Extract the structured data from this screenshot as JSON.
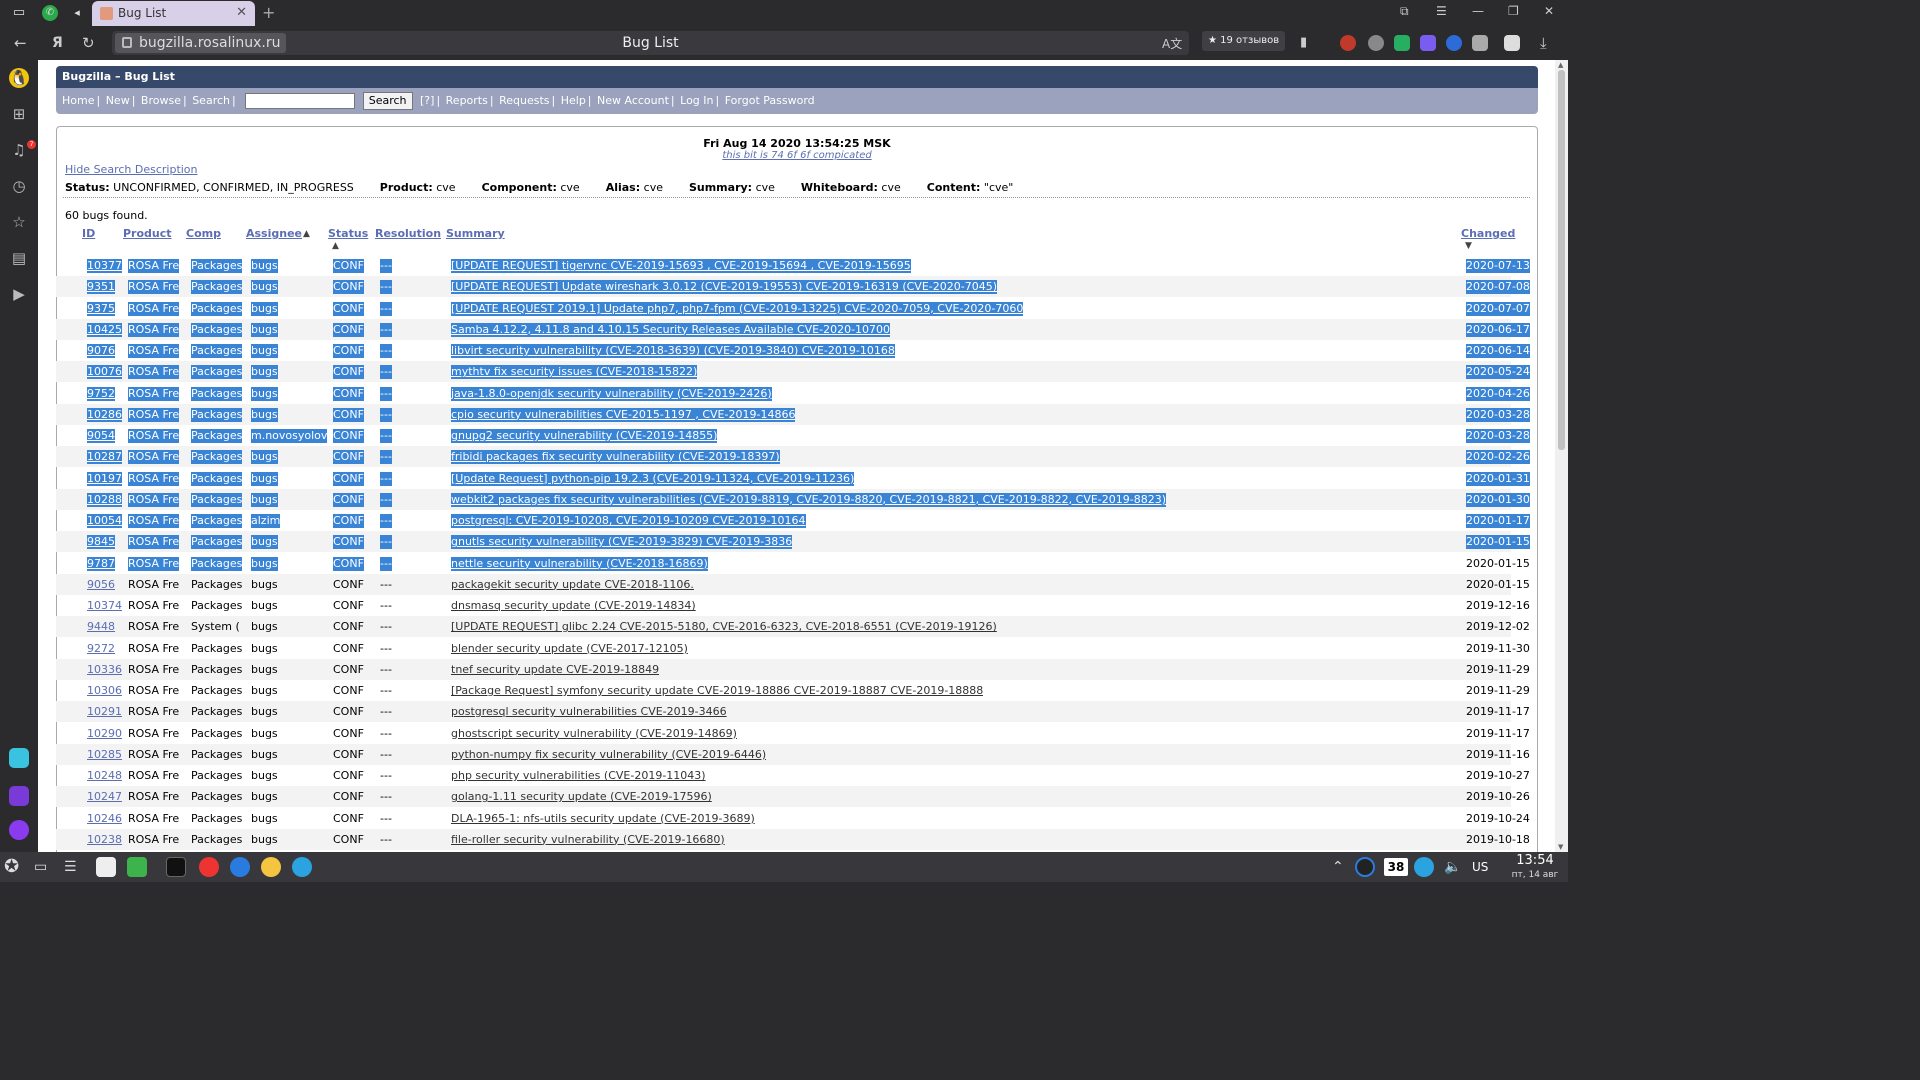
{
  "browser": {
    "tab_title": "Bug List",
    "url_host": "bugzilla.rosalinux.ru",
    "page_title": "Bug List",
    "reviews_label": "19 отзывов",
    "sidebar_notification_count": "7"
  },
  "bugzilla": {
    "header_title": "Bugzilla – Bug List",
    "nav_links": [
      "Home",
      "New",
      "Browse",
      "Search"
    ],
    "search_button": "Search",
    "help_link": "[?]",
    "nav_links_right": [
      "Reports",
      "Requests",
      "Help",
      "New Account",
      "Log In",
      "Forgot Password"
    ],
    "date_line": "Fri Aug 14 2020 13:54:25 MSK",
    "sub_line": "this bit is 74 6f 6f compicated",
    "hide_search_description": "Hide Search Description",
    "criteria": [
      {
        "label": "Status:",
        "value": "UNCONFIRMED, CONFIRMED, IN_PROGRESS"
      },
      {
        "label": "Product:",
        "value": "cve"
      },
      {
        "label": "Component:",
        "value": "cve"
      },
      {
        "label": "Alias:",
        "value": "cve"
      },
      {
        "label": "Summary:",
        "value": "cve"
      },
      {
        "label": "Whiteboard:",
        "value": "cve"
      },
      {
        "label": "Content:",
        "value": "\"cve\""
      }
    ],
    "bugs_found": "60 bugs found.",
    "columns": {
      "id": "ID",
      "product": "Product",
      "comp": "Comp",
      "assignee": "Assignee",
      "status": "Status",
      "resolution": "Resolution",
      "summary": "Summary",
      "changed": "Changed"
    },
    "rows": [
      {
        "id": "10377",
        "product": "ROSA Fre",
        "comp": "Packages",
        "assignee": "bugs",
        "status": "CONF",
        "resolution": "---",
        "summary": "[UPDATE REQUEST] tigervnc CVE-2019-15693 , CVE-2019-15694 , CVE-2019-15695",
        "changed": "2020-07-13",
        "selected": true
      },
      {
        "id": "9351",
        "product": "ROSA Fre",
        "comp": "Packages",
        "assignee": "bugs",
        "status": "CONF",
        "resolution": "---",
        "summary": "[UPDATE REQUEST] Update wireshark 3.0.12 (CVE-2019-19553) CVE-2019-16319 (CVE-2020-7045)",
        "changed": "2020-07-08",
        "selected": true
      },
      {
        "id": "9375",
        "product": "ROSA Fre",
        "comp": "Packages",
        "assignee": "bugs",
        "status": "CONF",
        "resolution": "---",
        "summary": "[UPDATE REQUEST 2019.1] Update php7, php7-fpm (CVE-2019-13225) CVE-2020-7059, CVE-2020-7060",
        "changed": "2020-07-07",
        "selected": true
      },
      {
        "id": "10425",
        "product": "ROSA Fre",
        "comp": "Packages",
        "assignee": "bugs",
        "status": "CONF",
        "resolution": "---",
        "summary": "Samba 4.12.2, 4.11.8 and 4.10.15 Security Releases Available CVE-2020-10700",
        "changed": "2020-06-17",
        "selected": true
      },
      {
        "id": "9076",
        "product": "ROSA Fre",
        "comp": "Packages",
        "assignee": "bugs",
        "status": "CONF",
        "resolution": "---",
        "summary": "libvirt security vulnerability (CVE-2018-3639) (CVE-2019-3840) CVE-2019-10168",
        "changed": "2020-06-14",
        "selected": true
      },
      {
        "id": "10076",
        "product": "ROSA Fre",
        "comp": "Packages",
        "assignee": "bugs",
        "status": "CONF",
        "resolution": "---",
        "summary": "mythtv fix security issues (CVE-2018-15822)",
        "changed": "2020-05-24",
        "selected": true
      },
      {
        "id": "9752",
        "product": "ROSA Fre",
        "comp": "Packages",
        "assignee": "bugs",
        "status": "CONF",
        "resolution": "---",
        "summary": "java-1.8.0-openjdk security vulnerability (CVE-2019-2426)",
        "changed": "2020-04-26",
        "selected": true
      },
      {
        "id": "10286",
        "product": "ROSA Fre",
        "comp": "Packages",
        "assignee": "bugs",
        "status": "CONF",
        "resolution": "---",
        "summary": "cpio security vulnerabilities CVE-2015-1197 , CVE-2019-14866",
        "changed": "2020-03-28",
        "selected": true
      },
      {
        "id": "9054",
        "product": "ROSA Fre",
        "comp": "Packages",
        "assignee": "m.novosyolov",
        "status": "CONF",
        "resolution": "---",
        "summary": "gnupg2 security vulnerability (CVE-2019-14855)",
        "changed": "2020-03-28",
        "selected": true
      },
      {
        "id": "10287",
        "product": "ROSA Fre",
        "comp": "Packages",
        "assignee": "bugs",
        "status": "CONF",
        "resolution": "---",
        "summary": "fribidi packages fix security vulnerability (CVE-2019-18397)",
        "changed": "2020-02-26",
        "selected": true
      },
      {
        "id": "10197",
        "product": "ROSA Fre",
        "comp": "Packages",
        "assignee": "bugs",
        "status": "CONF",
        "resolution": "---",
        "summary": "[Update Request] python-pip 19.2.3 (CVE-2019-11324, CVE-2019-11236)",
        "changed": "2020-01-31",
        "selected": true
      },
      {
        "id": "10288",
        "product": "ROSA Fre",
        "comp": "Packages",
        "assignee": "bugs",
        "status": "CONF",
        "resolution": "---",
        "summary": "webkit2 packages fix security vulnerabilities (CVE-2019-8819, CVE-2019-8820, CVE-2019-8821, CVE-2019-8822, CVE-2019-8823)",
        "changed": "2020-01-30",
        "selected": true
      },
      {
        "id": "10054",
        "product": "ROSA Fre",
        "comp": "Packages",
        "assignee": "alzim",
        "status": "CONF",
        "resolution": "---",
        "summary": "postgresql: CVE-2019-10208, CVE-2019-10209 CVE-2019-10164",
        "changed": "2020-01-17",
        "selected": true
      },
      {
        "id": "9845",
        "product": "ROSA Fre",
        "comp": "Packages",
        "assignee": "bugs",
        "status": "CONF",
        "resolution": "---",
        "summary": "gnutls security vulnerability (CVE-2019-3829) CVE-2019-3836",
        "changed": "2020-01-15",
        "selected": true
      },
      {
        "id": "9787",
        "product": "ROSA Fre",
        "comp": "Packages",
        "assignee": "bugs",
        "status": "CONF",
        "resolution": "---",
        "summary": "nettle security vulnerability (CVE-2018-16869)",
        "changed": "2020-01-15",
        "selected": true,
        "changed_plain": true
      },
      {
        "id": "9056",
        "product": "ROSA Fre",
        "comp": "Packages",
        "assignee": "bugs",
        "status": "CONF",
        "resolution": "---",
        "summary": "packagekit security update CVE-2018-1106.",
        "changed": "2020-01-15",
        "selected": false
      },
      {
        "id": "10374",
        "product": "ROSA Fre",
        "comp": "Packages",
        "assignee": "bugs",
        "status": "CONF",
        "resolution": "---",
        "summary": "dnsmasq security update (CVE-2019-14834)",
        "changed": "2019-12-16",
        "selected": false
      },
      {
        "id": "9448",
        "product": "ROSA Fre",
        "comp": "System (",
        "assignee": "bugs",
        "status": "CONF",
        "resolution": "---",
        "summary": "[UPDATE REQUEST] glibc 2.24 CVE-2015-5180, CVE-2016-6323, CVE-2018-6551 (CVE-2019-19126)",
        "changed": "2019-12-02",
        "selected": false
      },
      {
        "id": "9272",
        "product": "ROSA Fre",
        "comp": "Packages",
        "assignee": "bugs",
        "status": "CONF",
        "resolution": "---",
        "summary": "blender security update (CVE-2017-12105)",
        "changed": "2019-11-30",
        "selected": false
      },
      {
        "id": "10336",
        "product": "ROSA Fre",
        "comp": "Packages",
        "assignee": "bugs",
        "status": "CONF",
        "resolution": "---",
        "summary": "tnef security update CVE-2019-18849",
        "changed": "2019-11-29",
        "selected": false
      },
      {
        "id": "10306",
        "product": "ROSA Fre",
        "comp": "Packages",
        "assignee": "bugs",
        "status": "CONF",
        "resolution": "---",
        "summary": "[Package Request] symfony security update CVE-2019-18886 CVE-2019-18887 CVE-2019-18888",
        "changed": "2019-11-29",
        "selected": false
      },
      {
        "id": "10291",
        "product": "ROSA Fre",
        "comp": "Packages",
        "assignee": "bugs",
        "status": "CONF",
        "resolution": "---",
        "summary": "postgresql security vulnerabilities CVE-2019-3466",
        "changed": "2019-11-17",
        "selected": false
      },
      {
        "id": "10290",
        "product": "ROSA Fre",
        "comp": "Packages",
        "assignee": "bugs",
        "status": "CONF",
        "resolution": "---",
        "summary": "ghostscript security vulnerability (CVE-2019-14869)",
        "changed": "2019-11-17",
        "selected": false
      },
      {
        "id": "10285",
        "product": "ROSA Fre",
        "comp": "Packages",
        "assignee": "bugs",
        "status": "CONF",
        "resolution": "---",
        "summary": "python-numpy fix security vulnerability (CVE-2019-6446)",
        "changed": "2019-11-16",
        "selected": false
      },
      {
        "id": "10248",
        "product": "ROSA Fre",
        "comp": "Packages",
        "assignee": "bugs",
        "status": "CONF",
        "resolution": "---",
        "summary": "php security vulnerabilities (CVE-2019-11043)",
        "changed": "2019-10-27",
        "selected": false
      },
      {
        "id": "10247",
        "product": "ROSA Fre",
        "comp": "Packages",
        "assignee": "bugs",
        "status": "CONF",
        "resolution": "---",
        "summary": "golang-1.11 security update (CVE-2019-17596)",
        "changed": "2019-10-26",
        "selected": false
      },
      {
        "id": "10246",
        "product": "ROSA Fre",
        "comp": "Packages",
        "assignee": "bugs",
        "status": "CONF",
        "resolution": "---",
        "summary": "DLA-1965-1: nfs-utils security update (CVE-2019-3689)",
        "changed": "2019-10-24",
        "selected": false
      },
      {
        "id": "10238",
        "product": "ROSA Fre",
        "comp": "Packages",
        "assignee": "bugs",
        "status": "CONF",
        "resolution": "---",
        "summary": "file-roller security vulnerability (CVE-2019-16680)",
        "changed": "2019-10-18",
        "selected": false
      }
    ]
  },
  "taskbar": {
    "tray_number": "38",
    "lang": "US",
    "time": "13:54",
    "date": "пт, 14 авг"
  },
  "colors": {
    "header": "#37496b",
    "links_bar": "#9aa2bd",
    "selection": "#3a84d6",
    "link": "#5b6eb3"
  }
}
